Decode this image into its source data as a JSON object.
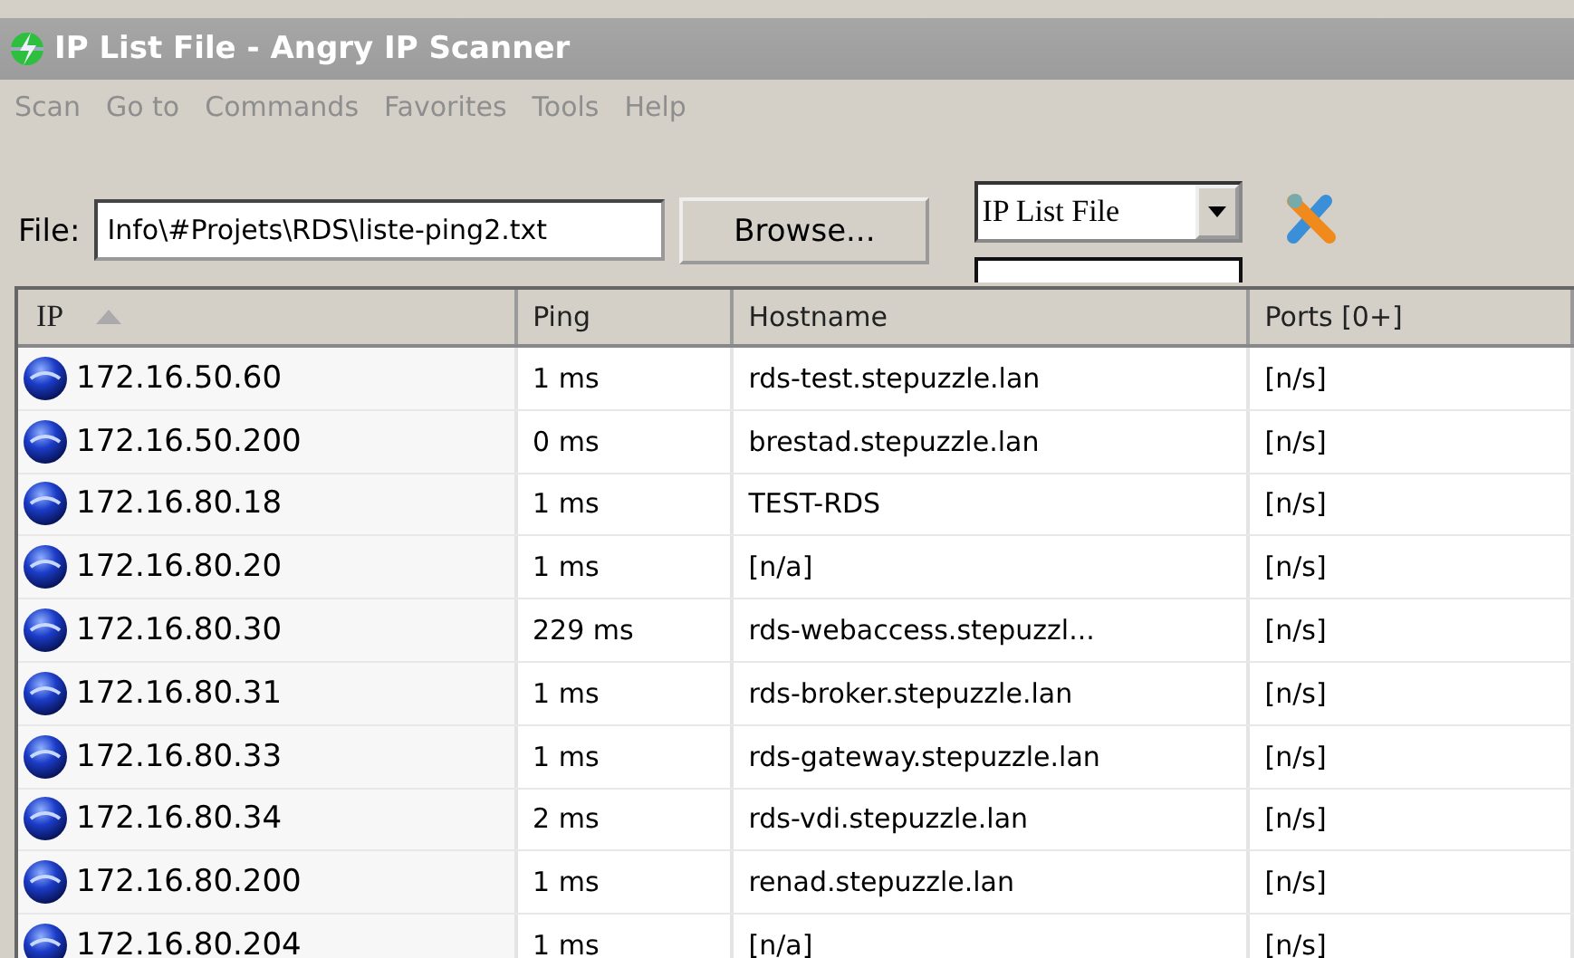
{
  "window": {
    "title": "IP List File - Angry IP Scanner"
  },
  "menu": [
    "Scan",
    "Go to",
    "Commands",
    "Favorites",
    "Tools",
    "Help"
  ],
  "toolbar": {
    "file_label": "File:",
    "file_value": "Info\\#Projets\\RDS\\liste-ping2.txt",
    "browse": "Browse...",
    "feeder": "IP List File"
  },
  "table": {
    "columns": [
      {
        "label": "IP",
        "sorted": true
      },
      {
        "label": "Ping",
        "sorted": false
      },
      {
        "label": "Hostname",
        "sorted": false
      },
      {
        "label": "Ports [0+]",
        "sorted": false
      }
    ],
    "rows": [
      {
        "ip": "172.16.50.60",
        "ping": "1 ms",
        "hostname": "rds-test.stepuzzle.lan",
        "ports": "[n/s]"
      },
      {
        "ip": "172.16.50.200",
        "ping": "0 ms",
        "hostname": "brestad.stepuzzle.lan",
        "ports": "[n/s]"
      },
      {
        "ip": "172.16.80.18",
        "ping": "1 ms",
        "hostname": "TEST-RDS",
        "ports": "[n/s]"
      },
      {
        "ip": "172.16.80.20",
        "ping": "1 ms",
        "hostname": "[n/a]",
        "ports": "[n/s]"
      },
      {
        "ip": "172.16.80.30",
        "ping": "229 ms",
        "hostname": "rds-webaccess.stepuzzl...",
        "ports": "[n/s]"
      },
      {
        "ip": "172.16.80.31",
        "ping": "1 ms",
        "hostname": "rds-broker.stepuzzle.lan",
        "ports": "[n/s]"
      },
      {
        "ip": "172.16.80.33",
        "ping": "1 ms",
        "hostname": "rds-gateway.stepuzzle.lan",
        "ports": "[n/s]"
      },
      {
        "ip": "172.16.80.34",
        "ping": "2 ms",
        "hostname": "rds-vdi.stepuzzle.lan",
        "ports": "[n/s]"
      },
      {
        "ip": "172.16.80.200",
        "ping": "1 ms",
        "hostname": "renad.stepuzzle.lan",
        "ports": "[n/s]"
      },
      {
        "ip": "172.16.80.204",
        "ping": "1 ms",
        "hostname": "[n/a]",
        "ports": "[n/s]"
      }
    ]
  }
}
